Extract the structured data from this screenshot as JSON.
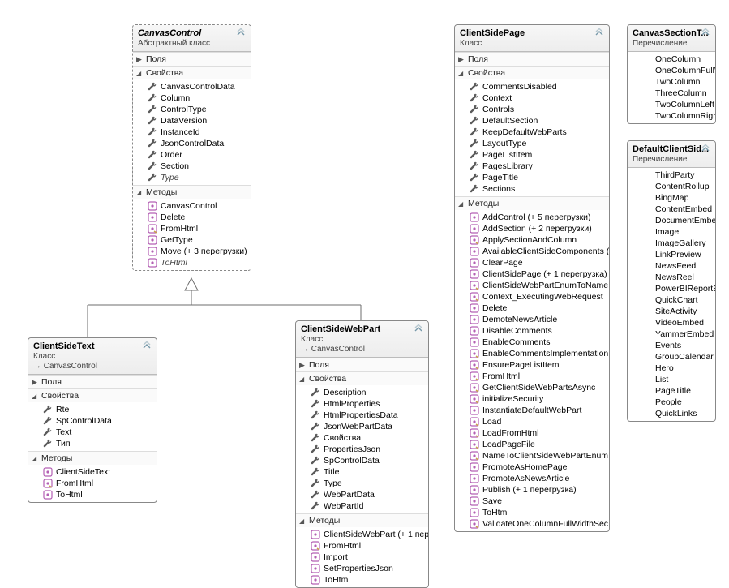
{
  "classes": {
    "CanvasControl": {
      "name": "CanvasControl",
      "kind": "Абстрактный класс",
      "abstract": true,
      "sections": [
        {
          "title": "Поля",
          "collapsed": true,
          "members": []
        },
        {
          "title": "Свойства",
          "collapsed": false,
          "members": [
            {
              "icon": "wrench",
              "label": "CanvasControlData"
            },
            {
              "icon": "wrench",
              "label": "Column"
            },
            {
              "icon": "wrench",
              "label": "ControlType"
            },
            {
              "icon": "wrench",
              "label": "DataVersion"
            },
            {
              "icon": "wrench",
              "label": "InstanceId"
            },
            {
              "icon": "wrench",
              "label": "JsonControlData"
            },
            {
              "icon": "wrench",
              "label": "Order"
            },
            {
              "icon": "wrench",
              "label": "Section"
            },
            {
              "icon": "wrench",
              "label": "Type",
              "italic": true
            }
          ]
        },
        {
          "title": "Методы",
          "collapsed": false,
          "members": [
            {
              "icon": "method",
              "label": "CanvasControl"
            },
            {
              "icon": "method",
              "label": "Delete"
            },
            {
              "icon": "method-static",
              "label": "FromHtml"
            },
            {
              "icon": "method",
              "label": "GetType"
            },
            {
              "icon": "method",
              "label": "Move (+ 3 перегрузки)"
            },
            {
              "icon": "method",
              "label": "ToHtml",
              "italic": true
            }
          ]
        }
      ]
    },
    "ClientSideText": {
      "name": "ClientSideText",
      "kind": "Класс",
      "base": "CanvasControl",
      "sections": [
        {
          "title": "Поля",
          "collapsed": true,
          "members": []
        },
        {
          "title": "Свойства",
          "collapsed": false,
          "members": [
            {
              "icon": "wrench",
              "label": "Rte"
            },
            {
              "icon": "wrench",
              "label": "SpControlData"
            },
            {
              "icon": "wrench",
              "label": "Text"
            },
            {
              "icon": "wrench",
              "label": "Тип"
            }
          ]
        },
        {
          "title": "Методы",
          "collapsed": false,
          "members": [
            {
              "icon": "method",
              "label": "ClientSideText"
            },
            {
              "icon": "method-static",
              "label": "FromHtml"
            },
            {
              "icon": "method",
              "label": "ToHtml"
            }
          ]
        }
      ]
    },
    "ClientSideWebPart": {
      "name": "ClientSideWebPart",
      "kind": "Класс",
      "base": "CanvasControl",
      "sections": [
        {
          "title": "Поля",
          "collapsed": true,
          "members": []
        },
        {
          "title": "Свойства",
          "collapsed": false,
          "members": [
            {
              "icon": "wrench",
              "label": "Description"
            },
            {
              "icon": "wrench",
              "label": "HtmlProperties"
            },
            {
              "icon": "wrench",
              "label": "HtmlPropertiesData"
            },
            {
              "icon": "wrench",
              "label": "JsonWebPartData"
            },
            {
              "icon": "wrench",
              "label": "Свойства"
            },
            {
              "icon": "wrench",
              "label": "PropertiesJson"
            },
            {
              "icon": "wrench",
              "label": "SpControlData"
            },
            {
              "icon": "wrench",
              "label": "Title"
            },
            {
              "icon": "wrench",
              "label": "Type"
            },
            {
              "icon": "wrench",
              "label": "WebPartData"
            },
            {
              "icon": "wrench",
              "label": "WebPartId"
            }
          ]
        },
        {
          "title": "Методы",
          "collapsed": false,
          "members": [
            {
              "icon": "method",
              "label": "ClientSideWebPart (+ 1 пер..."
            },
            {
              "icon": "method-static",
              "label": "FromHtml"
            },
            {
              "icon": "method",
              "label": "Import"
            },
            {
              "icon": "method",
              "label": "SetPropertiesJson"
            },
            {
              "icon": "method",
              "label": "ToHtml"
            }
          ]
        }
      ]
    },
    "ClientSidePage": {
      "name": "ClientSidePage",
      "kind": "Класс",
      "sections": [
        {
          "title": "Поля",
          "collapsed": true,
          "members": []
        },
        {
          "title": "Свойства",
          "collapsed": false,
          "members": [
            {
              "icon": "wrench",
              "label": "CommentsDisabled"
            },
            {
              "icon": "wrench",
              "label": "Context"
            },
            {
              "icon": "wrench",
              "label": "Controls"
            },
            {
              "icon": "wrench",
              "label": "DefaultSection"
            },
            {
              "icon": "wrench",
              "label": "KeepDefaultWebParts"
            },
            {
              "icon": "wrench",
              "label": "LayoutType"
            },
            {
              "icon": "wrench",
              "label": "PageListItem"
            },
            {
              "icon": "wrench",
              "label": "PagesLibrary"
            },
            {
              "icon": "wrench",
              "label": "PageTitle"
            },
            {
              "icon": "wrench",
              "label": "Sections"
            }
          ]
        },
        {
          "title": "Методы",
          "collapsed": false,
          "members": [
            {
              "icon": "method",
              "label": "AddControl (+ 5 перегрузки)"
            },
            {
              "icon": "method",
              "label": "AddSection (+ 2 перегрузки)"
            },
            {
              "icon": "method-static",
              "label": "ApplySectionAndColumn"
            },
            {
              "icon": "method",
              "label": "AvailableClientSideComponents (..."
            },
            {
              "icon": "method",
              "label": "ClearPage"
            },
            {
              "icon": "method",
              "label": "ClientSidePage (+ 1 перегрузка)"
            },
            {
              "icon": "method-static",
              "label": "ClientSideWebPartEnumToName"
            },
            {
              "icon": "method-static",
              "label": "Context_ExecutingWebRequest"
            },
            {
              "icon": "method",
              "label": "Delete"
            },
            {
              "icon": "method",
              "label": "DemoteNewsArticle"
            },
            {
              "icon": "method",
              "label": "DisableComments"
            },
            {
              "icon": "method",
              "label": "EnableComments"
            },
            {
              "icon": "method-static",
              "label": "EnableCommentsImplementation"
            },
            {
              "icon": "method-static",
              "label": "EnsurePageListItem"
            },
            {
              "icon": "method-static",
              "label": "FromHtml"
            },
            {
              "icon": "method-static",
              "label": "GetClientSideWebPartsAsync"
            },
            {
              "icon": "method-static",
              "label": "initializeSecurity"
            },
            {
              "icon": "method",
              "label": "InstantiateDefaultWebPart"
            },
            {
              "icon": "method-static",
              "label": "Load"
            },
            {
              "icon": "method-static",
              "label": "LoadFromHtml"
            },
            {
              "icon": "method-static",
              "label": "LoadPageFile"
            },
            {
              "icon": "method-static",
              "label": "NameToClientSideWebPartEnum"
            },
            {
              "icon": "method",
              "label": "PromoteAsHomePage"
            },
            {
              "icon": "method",
              "label": "PromoteAsNewsArticle"
            },
            {
              "icon": "method",
              "label": "Publish (+ 1 перегрузка)"
            },
            {
              "icon": "method",
              "label": "Save"
            },
            {
              "icon": "method",
              "label": "ToHtml"
            },
            {
              "icon": "method-static",
              "label": "ValidateOneColumnFullWidthSec..."
            }
          ]
        }
      ]
    },
    "CanvasSectionT": {
      "name": "CanvasSectionT...",
      "kind": "Перечисление",
      "sections": [
        {
          "title": "",
          "collapsed": false,
          "members": [
            {
              "icon": "",
              "label": "OneColumn"
            },
            {
              "icon": "",
              "label": "OneColumnFullWidth"
            },
            {
              "icon": "",
              "label": "TwoColumn"
            },
            {
              "icon": "",
              "label": "ThreeColumn"
            },
            {
              "icon": "",
              "label": "TwoColumnLeft"
            },
            {
              "icon": "",
              "label": "TwoColumnRight"
            }
          ]
        }
      ]
    },
    "DefaultClientSid": {
      "name": "DefaultClientSid...",
      "kind": "Перечисление",
      "sections": [
        {
          "title": "",
          "collapsed": false,
          "members": [
            {
              "icon": "",
              "label": "ThirdParty"
            },
            {
              "icon": "",
              "label": "ContentRollup"
            },
            {
              "icon": "",
              "label": "BingMap"
            },
            {
              "icon": "",
              "label": "ContentEmbed"
            },
            {
              "icon": "",
              "label": "DocumentEmbed"
            },
            {
              "icon": "",
              "label": "Image"
            },
            {
              "icon": "",
              "label": "ImageGallery"
            },
            {
              "icon": "",
              "label": "LinkPreview"
            },
            {
              "icon": "",
              "label": "NewsFeed"
            },
            {
              "icon": "",
              "label": "NewsReel"
            },
            {
              "icon": "",
              "label": "PowerBIReportEmbed"
            },
            {
              "icon": "",
              "label": "QuickChart"
            },
            {
              "icon": "",
              "label": "SiteActivity"
            },
            {
              "icon": "",
              "label": "VideoEmbed"
            },
            {
              "icon": "",
              "label": "YammerEmbed"
            },
            {
              "icon": "",
              "label": "Events"
            },
            {
              "icon": "",
              "label": "GroupCalendar"
            },
            {
              "icon": "",
              "label": "Hero"
            },
            {
              "icon": "",
              "label": "List"
            },
            {
              "icon": "",
              "label": "PageTitle"
            },
            {
              "icon": "",
              "label": "People"
            },
            {
              "icon": "",
              "label": "QuickLinks"
            }
          ]
        }
      ]
    }
  }
}
